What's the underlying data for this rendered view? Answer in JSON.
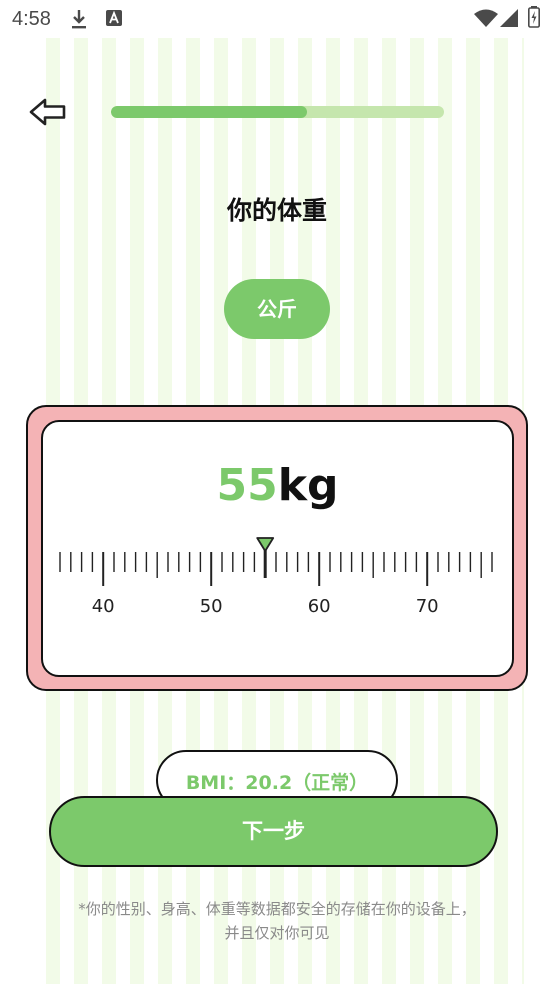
{
  "status_bar": {
    "time": "4:58",
    "icons": [
      "download-icon",
      "a-badge-icon",
      "wifi-icon",
      "signal-icon",
      "battery-charging-icon"
    ]
  },
  "header": {
    "progress_fraction": 0.59,
    "colors": {
      "progress_track": "#c5e6ad",
      "progress_fill": "#7cc96b"
    }
  },
  "page": {
    "title": "你的体重",
    "unit_label": "公斤"
  },
  "weight": {
    "value": "55",
    "unit": "kg",
    "current": 55,
    "scale": {
      "min": 36,
      "max": 76,
      "labels": [
        "40",
        "50",
        "60",
        "70"
      ]
    }
  },
  "bmi": {
    "text": "BMI：20.2（正常）"
  },
  "actions": {
    "next_label": "下一步"
  },
  "footnote": {
    "line1": "*你的性别、身高、体重等数据都安全的存储在你的设备上，",
    "line2": "并且仅对你可见"
  },
  "colors": {
    "accent": "#7cc96b",
    "card_frame": "#f4b3b5",
    "stripe": "#f2fbe8"
  }
}
